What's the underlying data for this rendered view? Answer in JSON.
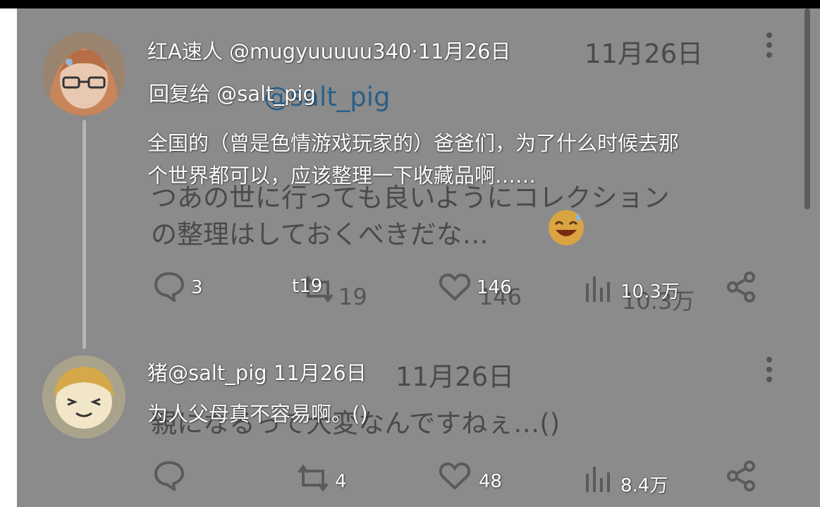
{
  "tweets": [
    {
      "header": "红A速人 @mugyuuuuu340·11月26日",
      "reply_to": "回复给 @salt_pig",
      "body_lines": [
        "全国的（曾是色情游戏玩家的）爸爸们，为了什么时候去那",
        "个世界都可以，应该整理一下收藏品啊……"
      ],
      "ghost_date": "11月26日",
      "ghost_reply": "@salt_pig",
      "ghost_lines": [
        "つあの世に行っても良いようにコレクション",
        "の整理はしておくべきだな…"
      ],
      "stats": {
        "reply": "3",
        "retweet": "t19",
        "retweet_ghost": "19",
        "like": "146",
        "like_ghost": "146",
        "views": "10.3万",
        "views_ghost": "10.3万"
      }
    },
    {
      "header": "猪@salt_pig 11月26日",
      "body_lines": [
        "为人父母真不容易啊。()"
      ],
      "ghost_date": "11月26日",
      "ghost_lines": [
        "親になるって大変なんですねぇ…()"
      ],
      "stats": {
        "reply": "",
        "retweet": "4",
        "like": "48",
        "views": "8.4万"
      }
    }
  ],
  "icons": {
    "reply": "comment-icon",
    "retweet": "retweet-icon",
    "like": "heart-icon",
    "views": "bar-chart-icon",
    "share": "share-icon",
    "more": "more-vertical-icon",
    "emoji": "sweat-smile-emoji"
  }
}
